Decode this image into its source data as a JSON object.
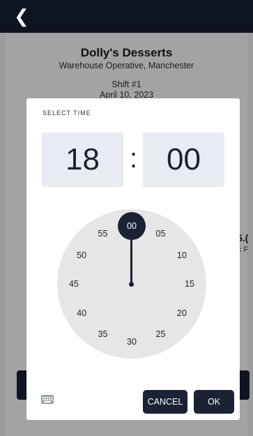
{
  "topbar": {
    "back_icon": "chevron-left-icon"
  },
  "background": {
    "company": "Dolly's Desserts",
    "role": "Warehouse Operative, Manchester",
    "shift": "Shift #1",
    "date": "April 10, 2023",
    "peek_num": "5.(",
    "peek_sub": "c F"
  },
  "dialog": {
    "title": "SELECT TIME",
    "hour": "18",
    "colon": ":",
    "minute": "00",
    "clock_numbers": [
      "00",
      "05",
      "10",
      "15",
      "20",
      "25",
      "30",
      "35",
      "40",
      "45",
      "50",
      "55"
    ],
    "selected_minute": "00",
    "keyboard_icon": "keyboard-icon",
    "cancel_label": "CANCEL",
    "ok_label": "OK"
  },
  "colors": {
    "dark": "#1a2234",
    "topbar": "#0e1420",
    "clock_face": "#e6e6e6",
    "time_box": "#e8ebf2"
  }
}
